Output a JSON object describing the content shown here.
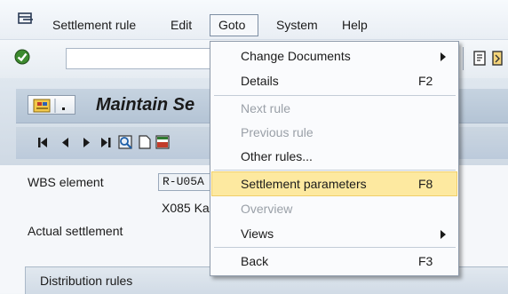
{
  "menubar": {
    "items": [
      {
        "label": "Settlement rule"
      },
      {
        "label": "Edit"
      },
      {
        "label": "Goto"
      },
      {
        "label": "System"
      },
      {
        "label": "Help"
      }
    ]
  },
  "toolbar": {
    "command_field_value": ""
  },
  "title": {
    "text": "Maintain Se"
  },
  "content": {
    "wbs_label": "WBS element",
    "wbs_value": "R-U05A",
    "description": "X085 Ka",
    "actual_settlement_label": "Actual settlement",
    "distribution_tab_label": "Distribution rules"
  },
  "goto_menu": {
    "items": [
      {
        "label": "Change Documents",
        "shortcut": "",
        "submenu": true,
        "enabled": true,
        "highlighted": false
      },
      {
        "label": "Details",
        "shortcut": "F2",
        "submenu": false,
        "enabled": true,
        "highlighted": false
      },
      {
        "label": "Next rule",
        "shortcut": "",
        "submenu": false,
        "enabled": false,
        "highlighted": false
      },
      {
        "label": "Previous rule",
        "shortcut": "",
        "submenu": false,
        "enabled": false,
        "highlighted": false
      },
      {
        "label": "Other rules...",
        "shortcut": "",
        "submenu": false,
        "enabled": true,
        "highlighted": false
      },
      {
        "label": "Settlement parameters",
        "shortcut": "F8",
        "submenu": false,
        "enabled": true,
        "highlighted": true
      },
      {
        "label": "Overview",
        "shortcut": "",
        "submenu": false,
        "enabled": false,
        "highlighted": false
      },
      {
        "label": "Views",
        "shortcut": "",
        "submenu": true,
        "enabled": true,
        "highlighted": false
      },
      {
        "label": "Back",
        "shortcut": "F3",
        "submenu": false,
        "enabled": true,
        "highlighted": false
      }
    ]
  },
  "colors": {
    "highlight": "#fde9a0",
    "disabled_text": "#9aa0a8"
  }
}
